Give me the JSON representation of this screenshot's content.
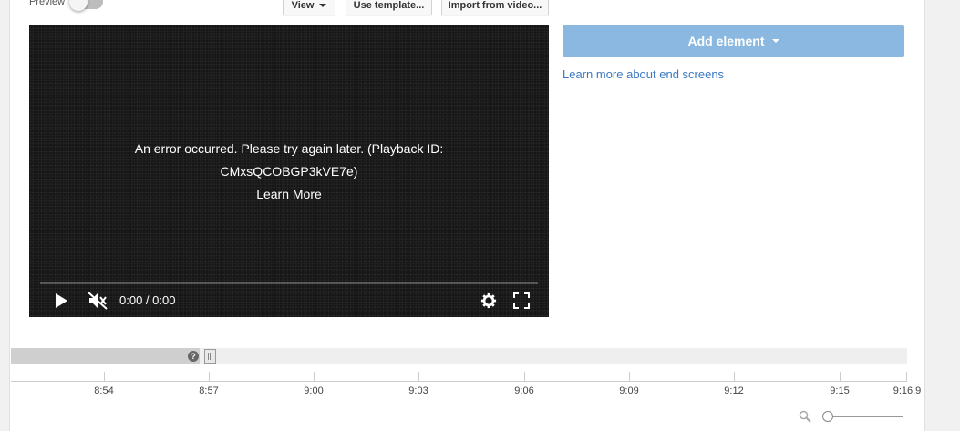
{
  "toolbar": {
    "preview_label": "Preview",
    "preview_on": false,
    "view_label": "View",
    "use_template_label": "Use template...",
    "import_label": "Import from video..."
  },
  "player": {
    "error_line1": "An error occurred. Please try again later. (Playback ID:",
    "error_line2": "CMxsQCOBGP3kVE7e)",
    "learn_more": "Learn More",
    "time": "0:00 / 0:00",
    "icons": [
      "play-icon",
      "muted-icon",
      "settings-icon",
      "fullscreen-icon"
    ]
  },
  "sidebar": {
    "add_element_label": "Add element",
    "learn_link": "Learn more about end screens",
    "accent": "#8ab8e0",
    "link_color": "#3b78c3"
  },
  "timeline": {
    "help_symbol": "?",
    "ticks": [
      "8:54",
      "8:57",
      "9:00",
      "9:03",
      "9:06",
      "9:09",
      "9:12",
      "9:15",
      "9:16.9"
    ]
  }
}
